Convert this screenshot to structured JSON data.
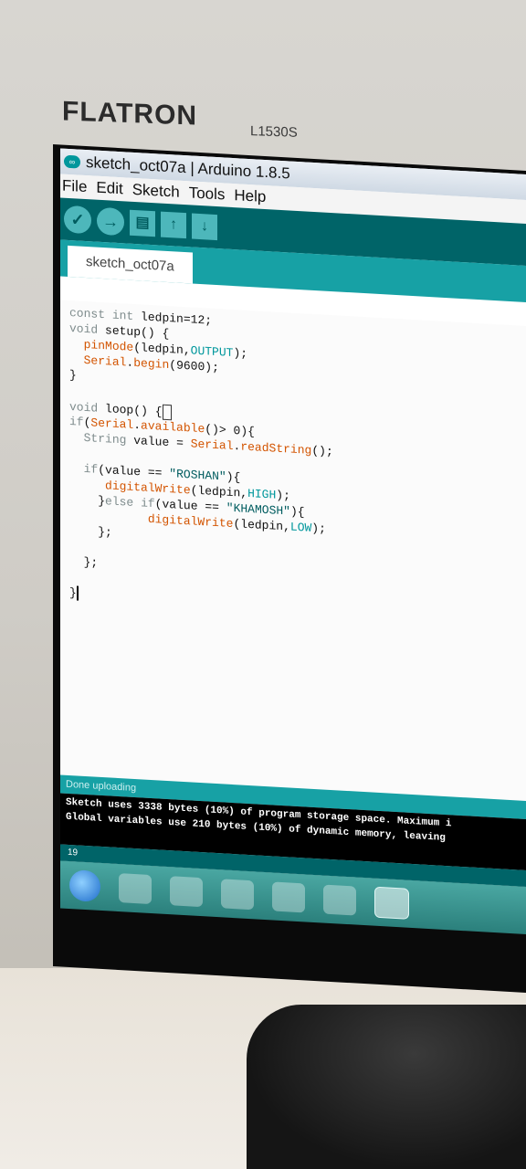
{
  "monitor": {
    "brand": "FLATRON",
    "model": "L1530S"
  },
  "window": {
    "title": "sketch_oct07a | Arduino 1.8.5"
  },
  "menu": [
    "File",
    "Edit",
    "Sketch",
    "Tools",
    "Help"
  ],
  "toolbar": {
    "verify": "✓",
    "upload": "→",
    "new": "▤",
    "open": "↑",
    "save": "↓"
  },
  "tab": {
    "label": "sketch_oct07a"
  },
  "editor": {
    "lines": [
      "const int ledpin=12;",
      "void setup() {",
      "  pinMode(ledpin,OUTPUT);",
      "  Serial.begin(9600);",
      "}",
      "",
      "void loop() {",
      "if(Serial.available()> 0){",
      "  String value = Serial.readString();",
      "",
      "  if(value == \"ROSHAN\"){",
      "     digitalWrite(ledpin,HIGH);",
      "    }else if(value == \"KHAMOSH\"){",
      "           digitalWrite(ledpin,LOW);",
      "    };",
      "",
      "  };",
      "",
      "}"
    ]
  },
  "status": {
    "text": "Done uploading"
  },
  "console": {
    "lines": [
      "Sketch uses 3338 bytes (10%) of program storage space. Maximum i",
      "Global variables use 210 bytes (10%) of dynamic memory, leaving"
    ]
  },
  "line_number": "19",
  "taskbar": {
    "icons": [
      "start-icon",
      "internet-explorer-icon",
      "file-explorer-icon",
      "media-player-icon",
      "chrome-icon",
      "folder-icon",
      "arduino-icon"
    ]
  }
}
